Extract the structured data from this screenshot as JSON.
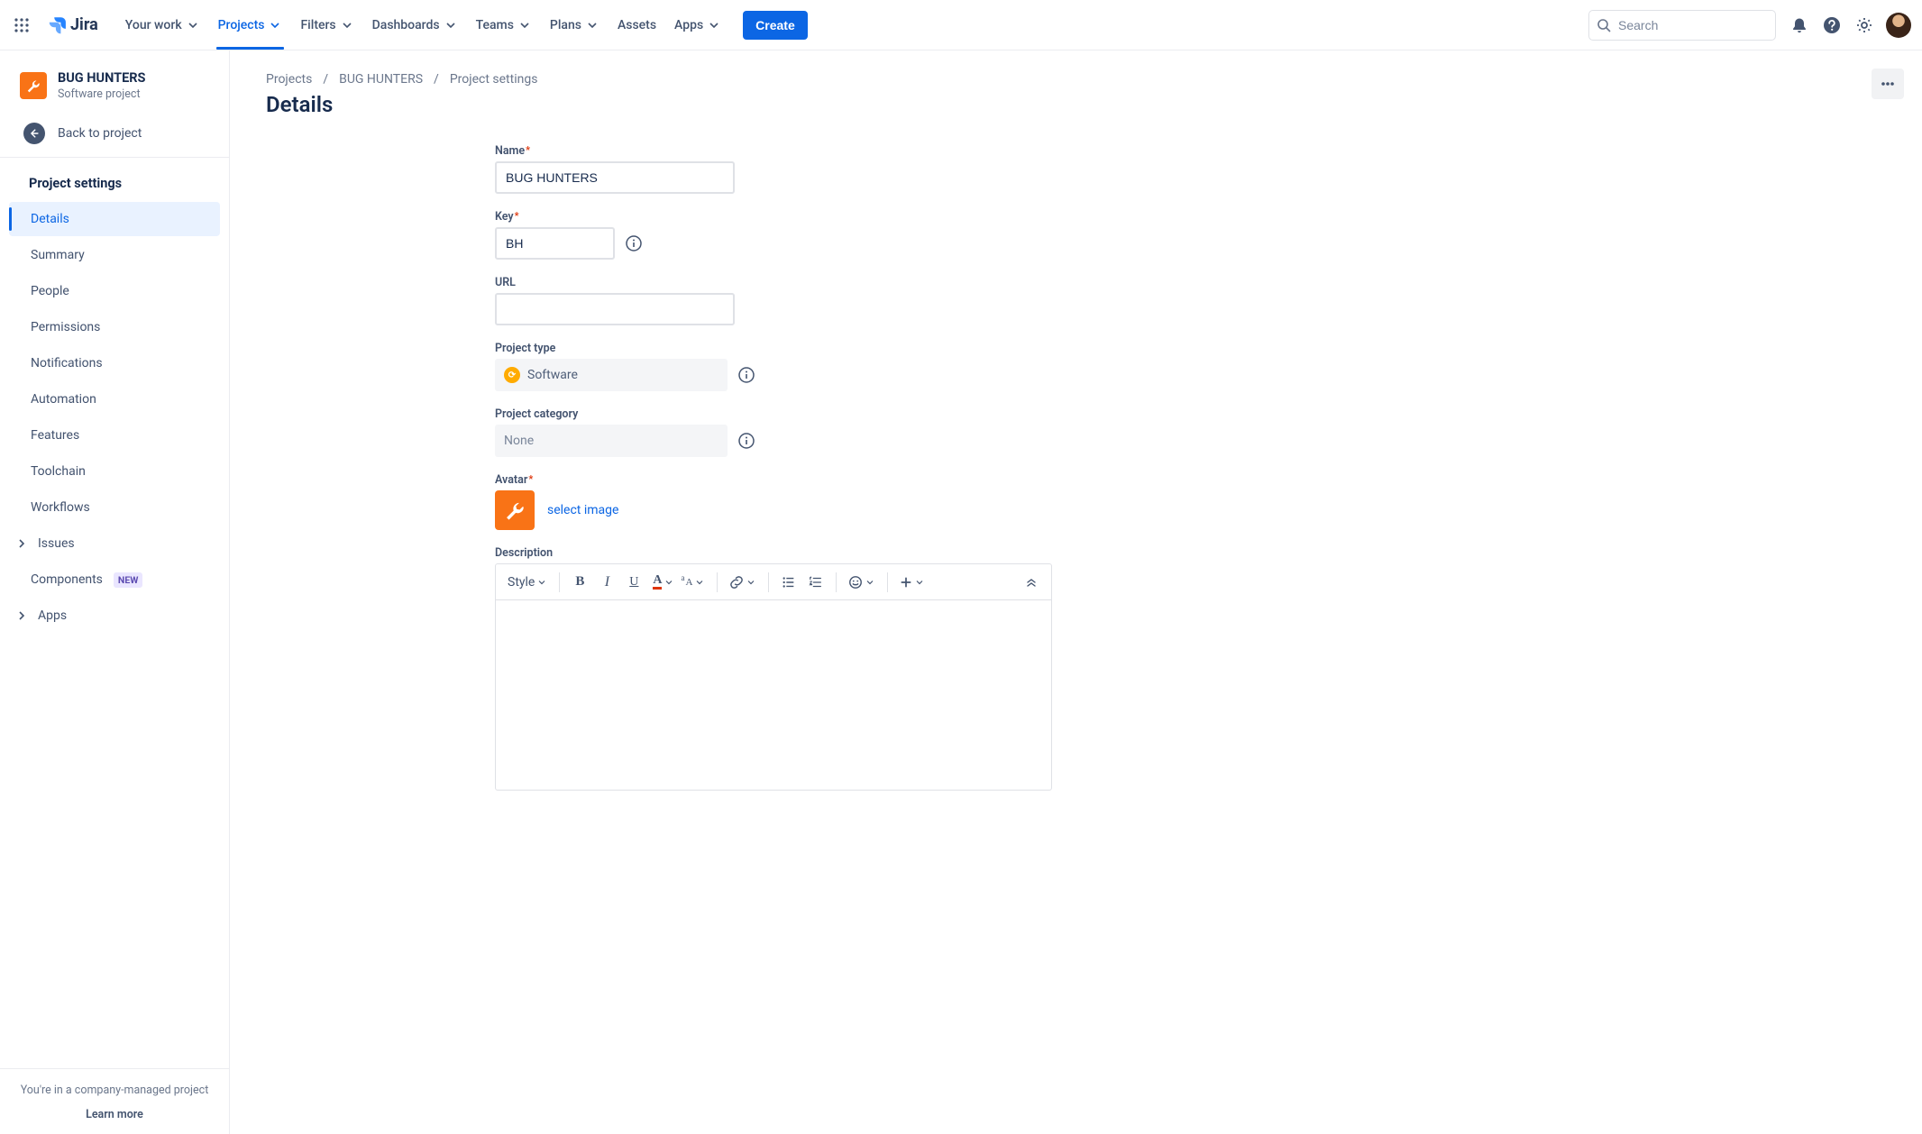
{
  "nav": {
    "product": "Jira",
    "items": [
      "Your work",
      "Projects",
      "Filters",
      "Dashboards",
      "Teams",
      "Plans",
      "Assets",
      "Apps"
    ],
    "active_index": 1,
    "create_label": "Create",
    "search_placeholder": "Search"
  },
  "sidebar": {
    "project_name": "BUG HUNTERS",
    "project_type": "Software project",
    "back_label": "Back to project",
    "heading": "Project settings",
    "items": [
      {
        "label": "Details",
        "selected": true
      },
      {
        "label": "Summary"
      },
      {
        "label": "People"
      },
      {
        "label": "Permissions"
      },
      {
        "label": "Notifications"
      },
      {
        "label": "Automation"
      },
      {
        "label": "Features"
      },
      {
        "label": "Toolchain"
      },
      {
        "label": "Workflows"
      },
      {
        "label": "Issues",
        "expandable": true
      },
      {
        "label": "Components",
        "badge": "NEW"
      },
      {
        "label": "Apps",
        "expandable": true
      }
    ],
    "footer_line": "You're in a company-managed project",
    "footer_link": "Learn more"
  },
  "breadcrumb": [
    "Projects",
    "BUG HUNTERS",
    "Project settings"
  ],
  "page_title": "Details",
  "form": {
    "name_label": "Name",
    "name_value": "BUG HUNTERS",
    "key_label": "Key",
    "key_value": "BH",
    "url_label": "URL",
    "url_value": "",
    "project_type_label": "Project type",
    "project_type_value": "Software",
    "project_category_label": "Project category",
    "project_category_value": "None",
    "avatar_label": "Avatar",
    "select_image_label": "select image",
    "description_label": "Description",
    "rte_style_label": "Style"
  }
}
